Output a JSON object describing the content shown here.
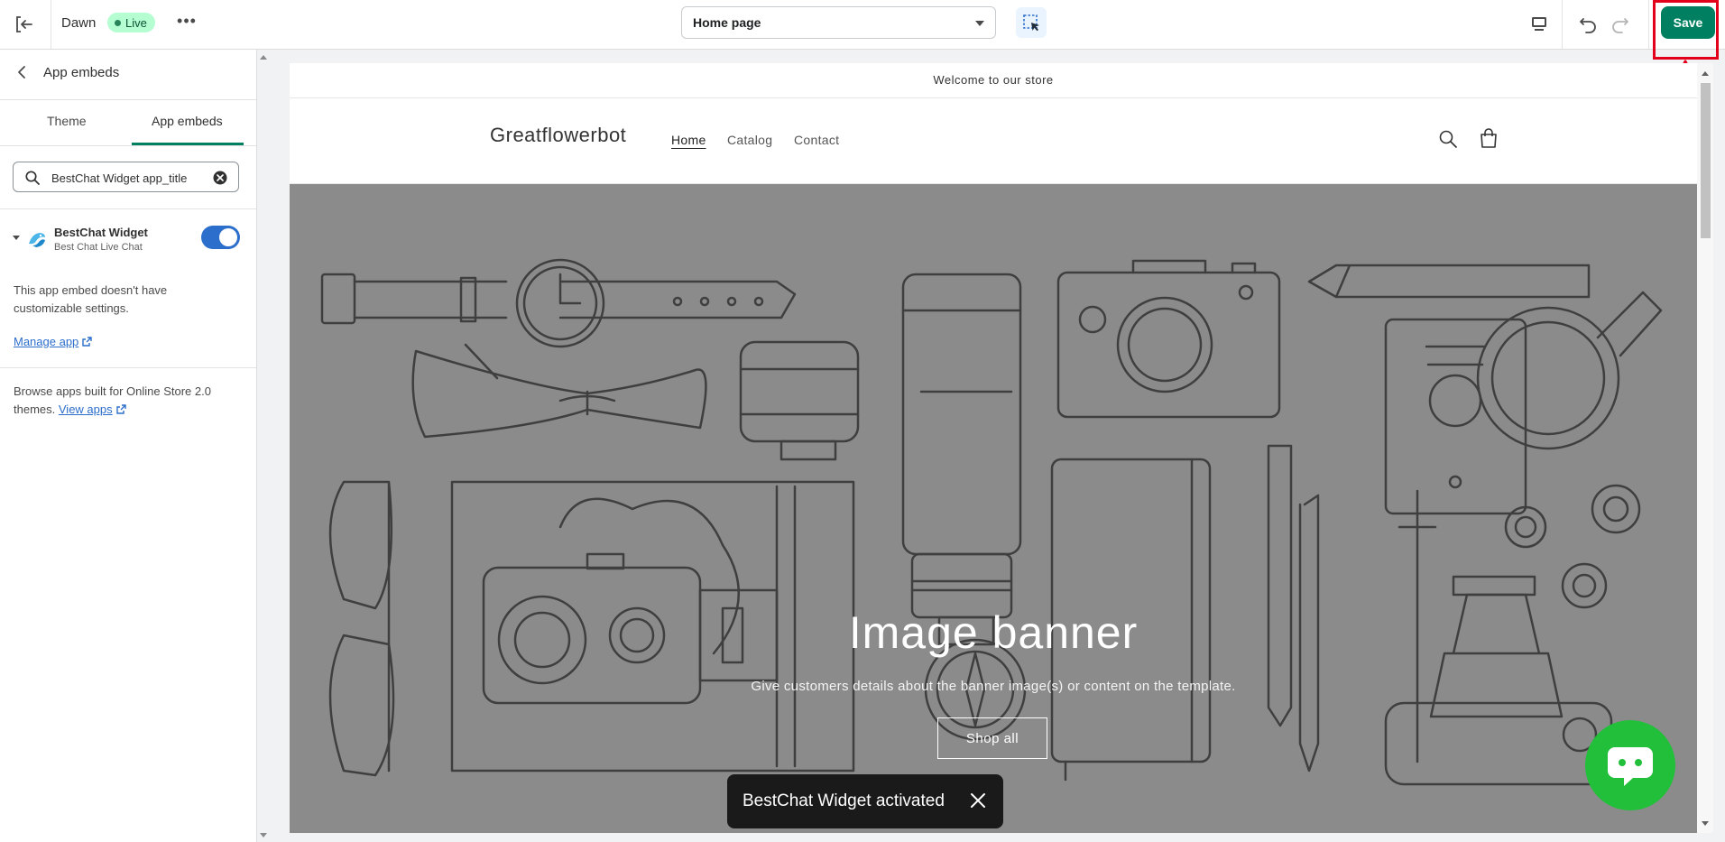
{
  "topbar": {
    "theme_name": "Dawn",
    "live_badge": "Live",
    "page_select": "Home page",
    "save_label": "Save"
  },
  "sidebar": {
    "title": "App embeds",
    "tabs": [
      {
        "label": "Theme",
        "active": false
      },
      {
        "label": "App embeds",
        "active": true
      }
    ],
    "search": {
      "value": "BestChat Widget app_title"
    },
    "embed": {
      "name": "BestChat Widget",
      "subtitle": "Best Chat Live Chat",
      "enabled": true
    },
    "info_text": "This app embed doesn't have customizable settings.",
    "manage_link": "Manage app",
    "browse_text": "Browse apps built for Online Store 2.0 themes.",
    "view_link": "View apps"
  },
  "preview": {
    "announcement": "Welcome to our store",
    "store_name": "Greatflowerbot",
    "nav": [
      "Home",
      "Catalog",
      "Contact"
    ],
    "banner": {
      "heading": "Image banner",
      "text": "Give customers details about the banner image(s) or content on the template.",
      "button": "Shop all"
    }
  },
  "toast": {
    "text": "BestChat Widget activated"
  },
  "colors": {
    "accent": "#008060",
    "toggle": "#2c6ecb",
    "highlight": "#e2001a",
    "chat": "#21bf3a",
    "banner_bg": "#8b8b8b"
  },
  "icons": [
    "exit-icon",
    "more-icon",
    "chevron-down-icon",
    "inspector-icon",
    "desktop-icon",
    "undo-icon",
    "redo-icon",
    "back-chevron-icon",
    "search-icon",
    "clear-icon",
    "bestchat-app-icon",
    "external-link-icon",
    "cart-icon",
    "close-icon",
    "chat-icon"
  ]
}
